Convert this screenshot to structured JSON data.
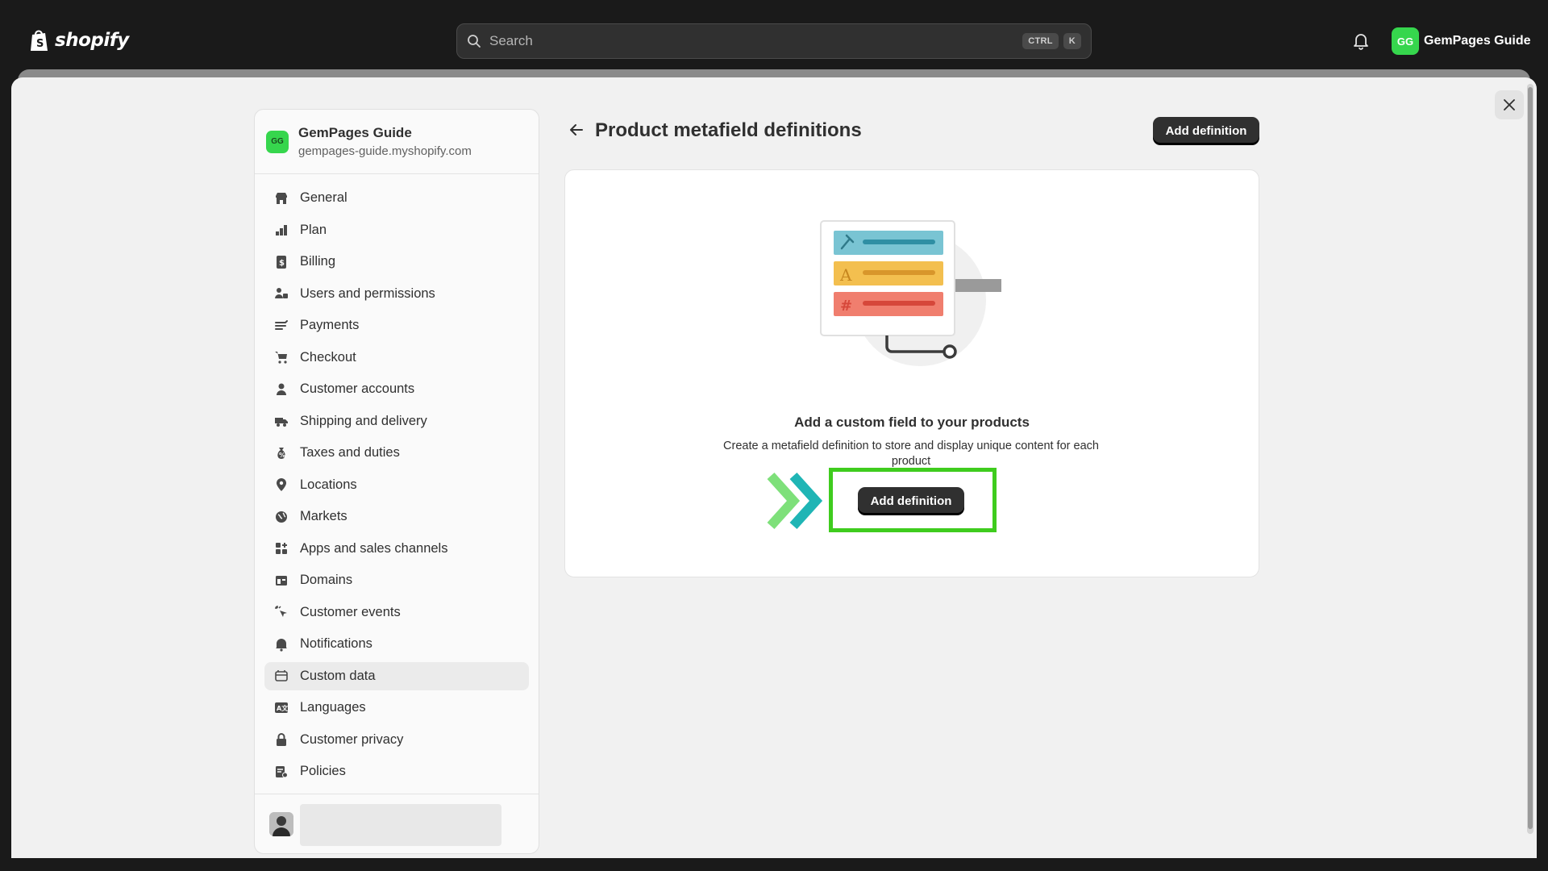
{
  "topbar": {
    "logo_text": "shopify",
    "search_placeholder": "Search",
    "shortcut_keys": [
      "CTRL",
      "K"
    ],
    "account_initials": "GG",
    "account_name": "GemPages Guide"
  },
  "sidebar": {
    "store_initials": "GG",
    "store_name": "GemPages Guide",
    "store_domain": "gempages-guide.myshopify.com",
    "items": [
      {
        "label": "General",
        "icon": "store-icon"
      },
      {
        "label": "Plan",
        "icon": "plan-icon"
      },
      {
        "label": "Billing",
        "icon": "billing-icon"
      },
      {
        "label": "Users and permissions",
        "icon": "users-icon"
      },
      {
        "label": "Payments",
        "icon": "payments-icon"
      },
      {
        "label": "Checkout",
        "icon": "cart-icon"
      },
      {
        "label": "Customer accounts",
        "icon": "person-icon"
      },
      {
        "label": "Shipping and delivery",
        "icon": "truck-icon"
      },
      {
        "label": "Taxes and duties",
        "icon": "tax-icon"
      },
      {
        "label": "Locations",
        "icon": "location-pin-icon"
      },
      {
        "label": "Markets",
        "icon": "globe-icon"
      },
      {
        "label": "Apps and sales channels",
        "icon": "apps-icon"
      },
      {
        "label": "Domains",
        "icon": "domain-icon"
      },
      {
        "label": "Customer events",
        "icon": "cursor-click-icon"
      },
      {
        "label": "Notifications",
        "icon": "bell-icon"
      },
      {
        "label": "Custom data",
        "icon": "custom-data-icon",
        "active": true
      },
      {
        "label": "Languages",
        "icon": "language-icon"
      },
      {
        "label": "Customer privacy",
        "icon": "lock-icon"
      },
      {
        "label": "Policies",
        "icon": "policy-icon"
      }
    ]
  },
  "main": {
    "page_title": "Product metafield definitions",
    "add_button_label": "Add definition",
    "empty_state": {
      "heading": "Add a custom field to your products",
      "description": "Create a metafield definition to store and display unique content for each product",
      "button_label": "Add definition"
    }
  },
  "colors": {
    "topbar_bg": "#1a1a1a",
    "brand_green": "#36d64d",
    "highlight_green": "#3fcc1e",
    "primary_button": "#303030",
    "chevron_light": "#7ee07a",
    "chevron_teal": "#1fb5b5"
  }
}
